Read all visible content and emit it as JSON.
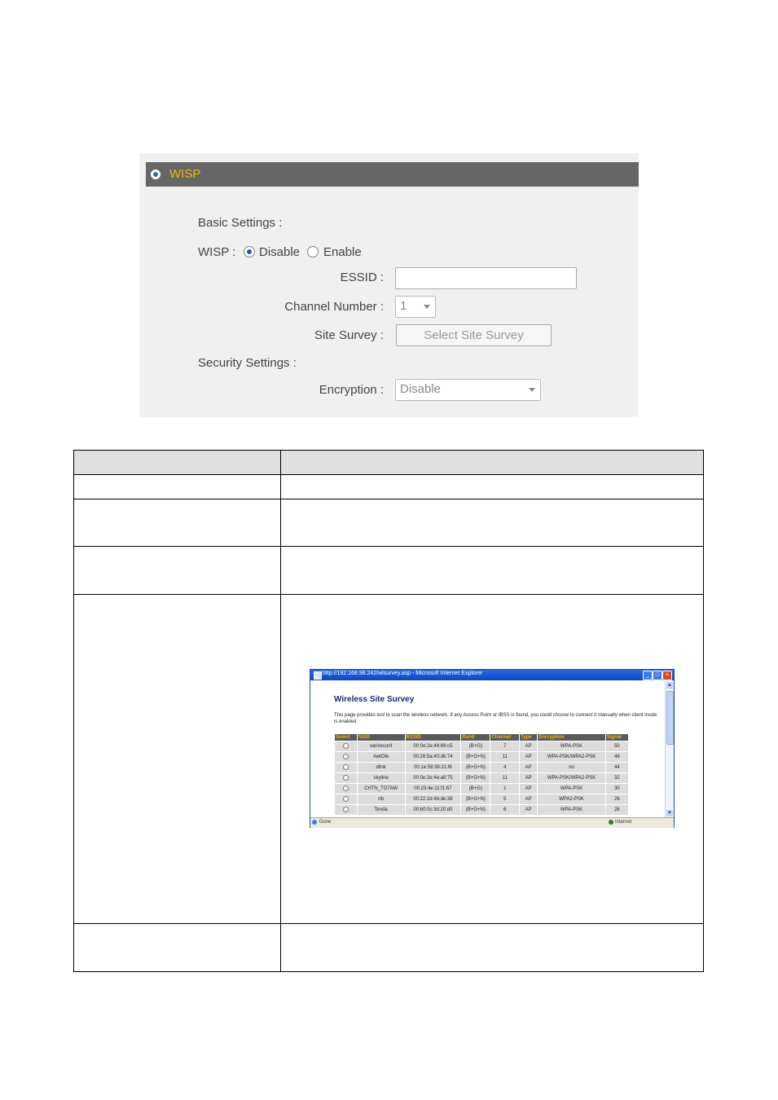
{
  "wisp_panel": {
    "header_title": "WISP",
    "basic_settings_label": "Basic Settings :",
    "wisp_label": "WISP :",
    "wisp_options": [
      "Disable",
      "Enable"
    ],
    "wisp_selected": "Disable",
    "essid_label": "ESSID :",
    "essid_value": "",
    "channel_label": "Channel Number :",
    "channel_value": "1",
    "site_survey_label": "Site Survey :",
    "site_survey_button": "Select Site Survey",
    "security_settings_label": "Security Settings :",
    "encryption_label": "Encryption :",
    "encryption_value": "Disable"
  },
  "site_survey_window": {
    "title": "http://192.168.98.242/wlsurvey.asp - Microsoft Internet Explorer",
    "heading": "Wireless Site Survey",
    "description": "This page provides tool to scan the wireless network. If any Access Point or IBSS is found, you could choose to connect it manually when client mode is enabled.",
    "columns": [
      "Select",
      "SSID",
      "BSSID",
      "Band",
      "Channel",
      "Type",
      "Encryption",
      "Signal"
    ],
    "rows": [
      {
        "ssid": "varioxconf",
        "bssid": "00:0e:2e:44:69:c5",
        "band": "(B+G)",
        "channel": "7",
        "type": "AP",
        "encryption": "WPA-PSK",
        "signal": "50"
      },
      {
        "ssid": "AwtOfe",
        "bssid": "00:26:5a:40:d6:74",
        "band": "(B+G+N)",
        "channel": "11",
        "type": "AP",
        "encryption": "WPA-PSK/WPA2-PSK",
        "signal": "48"
      },
      {
        "ssid": "dlink",
        "bssid": "00:1e:58:39:21:f6",
        "band": "(B+G+N)",
        "channel": "4",
        "type": "AP",
        "encryption": "no",
        "signal": "44"
      },
      {
        "ssid": "skyline",
        "bssid": "00:0e:2e:4e:a8:75",
        "band": "(B+G+N)",
        "channel": "11",
        "type": "AP",
        "encryption": "WPA-PSK/WPA2-PSK",
        "signal": "32"
      },
      {
        "ssid": "CHTN_TO7AW",
        "bssid": "00:23:4e:11:f1:67",
        "band": "(B+G)",
        "channel": "1",
        "type": "AP",
        "encryption": "WPA-PSK",
        "signal": "30"
      },
      {
        "ssid": "rtb",
        "bssid": "00:22:2d:4b:de:38",
        "band": "(B+G+N)",
        "channel": "5",
        "type": "AP",
        "encryption": "WPA2-PSK",
        "signal": "26"
      },
      {
        "ssid": "Tenda",
        "bssid": "00:b0:0c:3d:20:d0",
        "band": "(B+G+N)",
        "channel": "6",
        "type": "AP",
        "encryption": "WPA-PSK",
        "signal": "26"
      }
    ],
    "status_left": "Done",
    "status_zone": "Internet"
  }
}
